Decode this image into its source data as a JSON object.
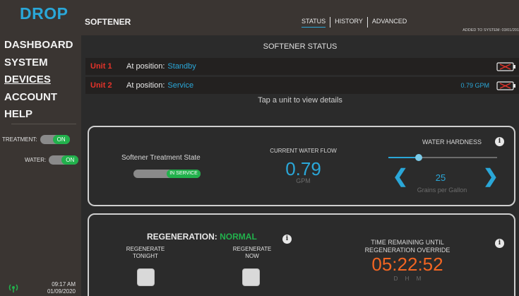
{
  "brand": {
    "logo": "DROP"
  },
  "sidebar": {
    "items": [
      {
        "label": "DASHBOARD"
      },
      {
        "label": "SYSTEM"
      },
      {
        "label": "DEVICES"
      },
      {
        "label": "ACCOUNT"
      },
      {
        "label": "HELP"
      }
    ],
    "active": "DEVICES",
    "treatment": {
      "label": "TREATMENT:",
      "state": "ON"
    },
    "water": {
      "label": "WATER:",
      "state": "ON"
    },
    "time": "09:17 AM",
    "date": "01/09/2020"
  },
  "header": {
    "title": "SOFTENER",
    "tabs": [
      {
        "label": "STATUS",
        "active": true
      },
      {
        "label": "HISTORY",
        "active": false
      },
      {
        "label": "ADVANCED",
        "active": false
      }
    ],
    "added": "ADDED TO SYSTEM: 03/01/201"
  },
  "status": {
    "title": "SOFTENER STATUS",
    "units": [
      {
        "name": "Unit 1",
        "position_label": "At position:",
        "position": "Standby",
        "gpm": ""
      },
      {
        "name": "Unit 2",
        "position_label": "At position:",
        "position": "Service",
        "gpm": "0.79 GPM"
      }
    ],
    "hint": "Tap a unit to view details"
  },
  "treatment_panel": {
    "state_label": "Softener Treatment State",
    "state_value": "IN SERVICE",
    "flow_label": "CURRENT WATER FLOW",
    "flow_value": "0.79",
    "flow_unit": "GPM",
    "hardness_label": "WATER HARDNESS",
    "hardness_value": "25",
    "hardness_unit": "Grains per Gallon",
    "hardness_slider_fraction": 0.28
  },
  "regeneration": {
    "title": "REGENERATION:",
    "status": "NORMAL",
    "tonight_label_1": "REGENERATE",
    "tonight_label_2": "TONIGHT",
    "now_label_1": "REGENERATE",
    "now_label_2": "NOW",
    "time_label_1": "TIME REMAINING UNTIL",
    "time_label_2": "REGENERATION OVERRIDE",
    "time_value": "05:22:52",
    "time_units": "D H M"
  },
  "colors": {
    "accent": "#2aa7d8",
    "alert": "#e5332a",
    "ok": "#22b14c",
    "timer": "#f26522"
  },
  "icons": {
    "info": "info-icon",
    "left": "chevron-left-icon",
    "right": "chevron-right-icon",
    "battery": "battery-empty-icon",
    "signal": "signal-icon"
  }
}
